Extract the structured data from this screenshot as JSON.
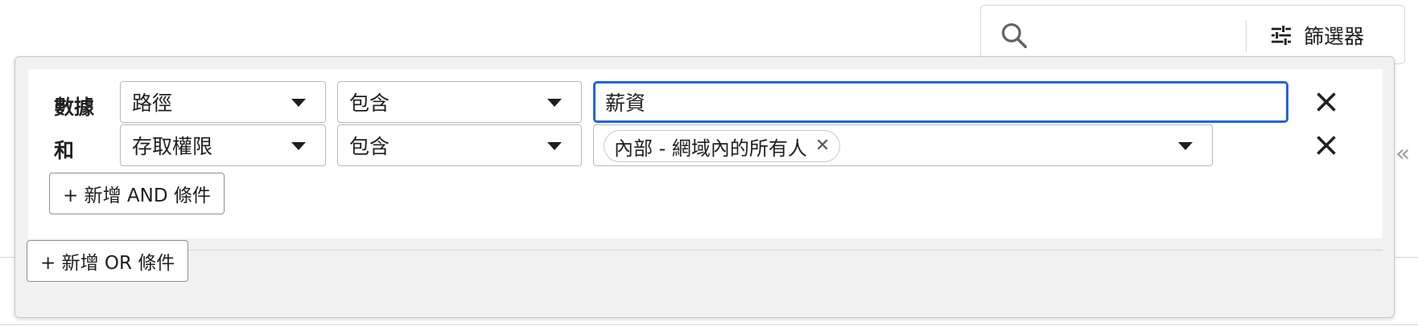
{
  "topbar": {
    "search_placeholder": "",
    "filter_label": "篩選器"
  },
  "filter_panel": {
    "rows": [
      {
        "label": "數據",
        "field": "路徑",
        "operator": "包含",
        "value": "薪資"
      },
      {
        "label": "和",
        "field": "存取權限",
        "operator": "包含",
        "value_chip": "內部 - 網域內的所有人"
      }
    ],
    "add_and_label": "+ 新增 AND 條件",
    "add_or_label": "+ 新增 OR 條件"
  },
  "icons": {
    "search": "search-icon",
    "filter": "tune-icon",
    "caret": "caret-down-icon",
    "remove": "close-icon",
    "collapse": "double-chevron-left-icon"
  },
  "colors": {
    "focus_border": "#2563d9",
    "panel_bg": "#f1f1f2"
  }
}
